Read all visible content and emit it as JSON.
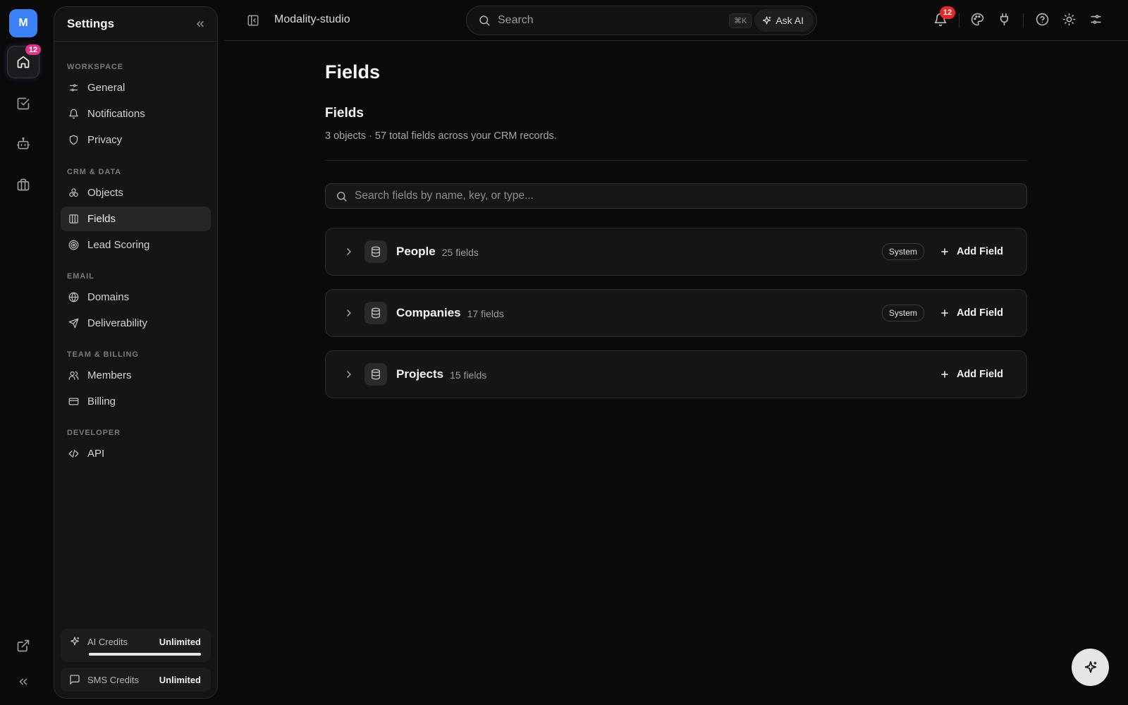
{
  "rail": {
    "avatar_letter": "M",
    "home_badge": "12"
  },
  "settings": {
    "title": "Settings",
    "sections": [
      {
        "label": "WORKSPACE",
        "items": [
          {
            "label": "General",
            "icon": "sliders-icon"
          },
          {
            "label": "Notifications",
            "icon": "bell-icon"
          },
          {
            "label": "Privacy",
            "icon": "shield-icon"
          }
        ]
      },
      {
        "label": "CRM & DATA",
        "items": [
          {
            "label": "Objects",
            "icon": "shapes-icon"
          },
          {
            "label": "Fields",
            "icon": "columns-icon"
          },
          {
            "label": "Lead Scoring",
            "icon": "target-icon"
          }
        ]
      },
      {
        "label": "EMAIL",
        "items": [
          {
            "label": "Domains",
            "icon": "globe-icon"
          },
          {
            "label": "Deliverability",
            "icon": "send-icon"
          }
        ]
      },
      {
        "label": "TEAM & BILLING",
        "items": [
          {
            "label": "Members",
            "icon": "users-icon"
          },
          {
            "label": "Billing",
            "icon": "credit-card-icon"
          }
        ]
      },
      {
        "label": "DEVELOPER",
        "items": [
          {
            "label": "API",
            "icon": "code-icon"
          }
        ]
      }
    ],
    "active_item": "Fields",
    "credits": {
      "ai": {
        "label": "AI Credits",
        "value": "Unlimited",
        "fill_fraction": 1.0
      },
      "sms": {
        "label": "SMS Credits",
        "value": "Unlimited"
      }
    }
  },
  "topbar": {
    "workspace_name": "Modality-studio",
    "search_placeholder": "Search",
    "shortcut": "⌘K",
    "ask_ai_label": "Ask AI",
    "notification_count": "12"
  },
  "main": {
    "page_title": "Fields",
    "section_title": "Fields",
    "section_subtitle": "3 objects · 57 total fields across your CRM records.",
    "search_placeholder": "Search fields by name, key, or type...",
    "objects": [
      {
        "name": "People",
        "count": "25 fields",
        "badge": "System",
        "action": "Add Field"
      },
      {
        "name": "Companies",
        "count": "17 fields",
        "badge": "System",
        "action": "Add Field"
      },
      {
        "name": "Projects",
        "count": "15 fields",
        "badge": "",
        "action": "Add Field"
      }
    ]
  },
  "colors": {
    "background": "#0a0a0a",
    "panel": "#141414",
    "accent_blue": "#3b82f6",
    "badge_pink": "#e0338a",
    "badge_red": "#e5292b"
  }
}
